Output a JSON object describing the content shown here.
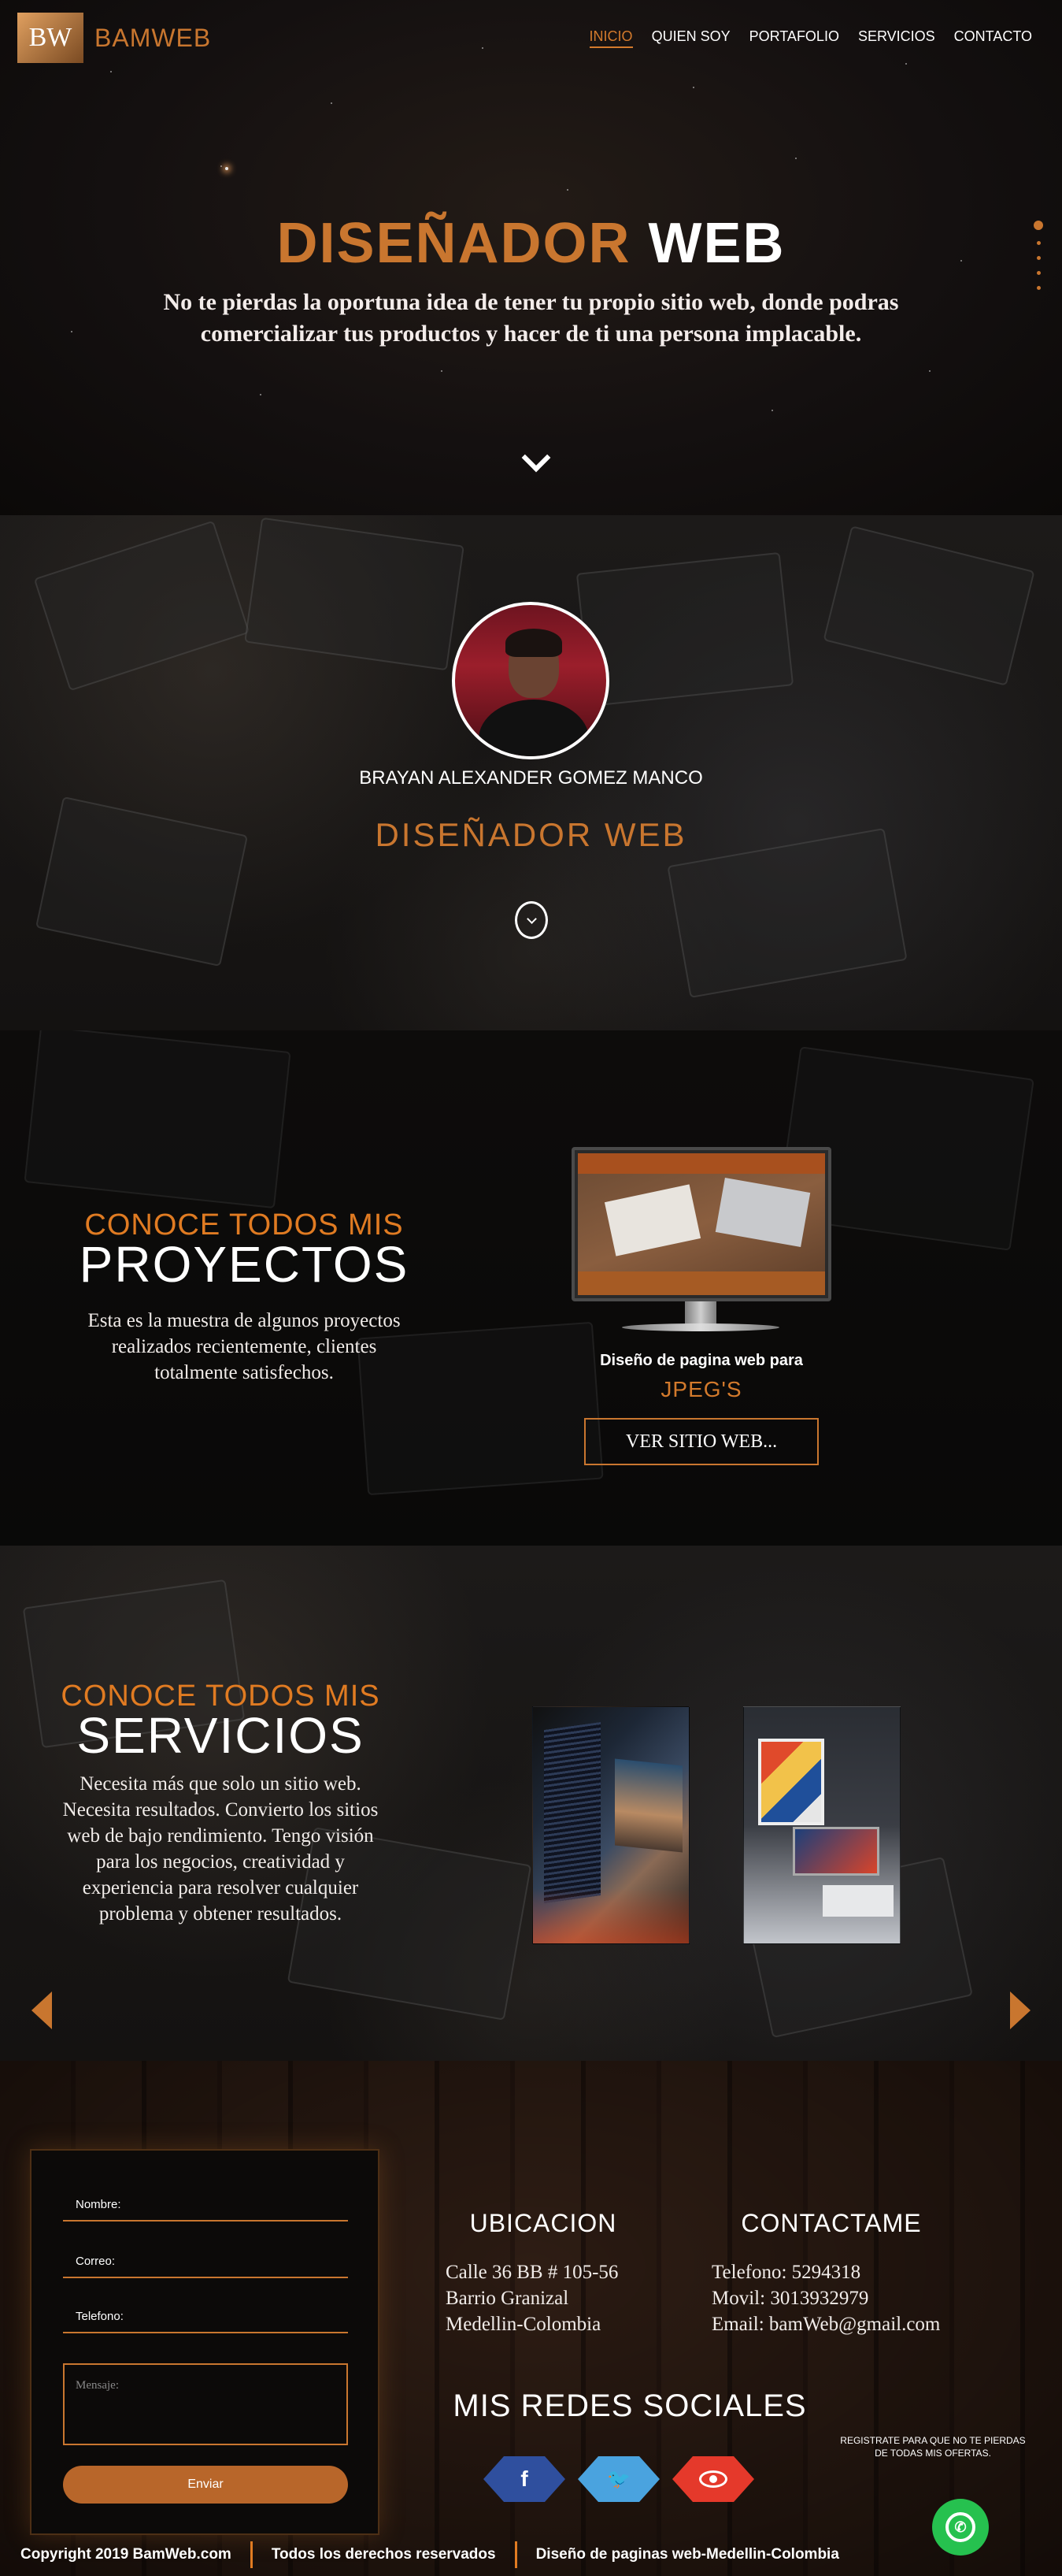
{
  "header": {
    "logo_mark": "BW",
    "logo_text": "BAMWEB",
    "nav": [
      {
        "label": "INICIO",
        "active": true
      },
      {
        "label": "QUIEN SOY"
      },
      {
        "label": "PORTAFOLIO"
      },
      {
        "label": "SERVICIOS"
      },
      {
        "label": "CONTACTO"
      }
    ]
  },
  "hero": {
    "title_orange": "DISEÑADOR",
    "title_white": "WEB",
    "subtitle": "No te pierdas la oportuna idea de tener tu propio sitio web, donde podras comercializar tus productos y hacer de ti una persona implacable.",
    "scroll_icon": "chevron-down-icon"
  },
  "profile": {
    "name": "BRAYAN ALEXANDER GOMEZ MANCO",
    "role": "DISEÑADOR WEB"
  },
  "projects": {
    "kicker": "CONOCE TODOS MIS",
    "title": "PROYECTOS",
    "text": "Esta es la muestra de algunos proyectos realizados recientemente, clientes totalmente satisfechos.",
    "caption": "Diseño de pagina web para",
    "project_name": "JPEG'S",
    "button_label": "VER SITIO WEB..."
  },
  "services": {
    "kicker": "CONOCE TODOS MIS",
    "title": "SERVICIOS",
    "text": "Necesita más que solo un sitio web. Necesita resultados. Convierto los sitios web de bajo rendimiento. Tengo visión para los negocios, creatividad y experiencia para resolver cualquier problema y obtener resultados."
  },
  "contact_form": {
    "name_label": "Nombre:",
    "email_label": "Correo:",
    "phone_label": "Telefono:",
    "message_placeholder": "Mensaje:",
    "send_label": "Enviar"
  },
  "location": {
    "title": "UBICACION",
    "lines": [
      "Calle 36 BB # 105-56",
      "Barrio Granizal",
      "Medellin-Colombia"
    ]
  },
  "contact": {
    "title": "CONTACTAME",
    "lines": [
      "Telefono: 5294318",
      "Movil: 3013932979",
      "Email: bamWeb@gmail.com"
    ]
  },
  "social": {
    "title": "MIS REDES SOCIALES",
    "icons": [
      "facebook-icon",
      "twitter-icon",
      "eye-icon"
    ],
    "subscribe": "REGISTRATE PARA QUE NO TE PIERDAS DE TODAS MIS OFERTAS."
  },
  "footer": {
    "copyright": "Copyright 2019 BamWeb.com",
    "rights": "Todos los derechos reservados",
    "tagline": "Diseño de paginas web-Medellin-Colombia"
  },
  "colors": {
    "accent": "#c9762f",
    "whatsapp": "#26c14f"
  }
}
